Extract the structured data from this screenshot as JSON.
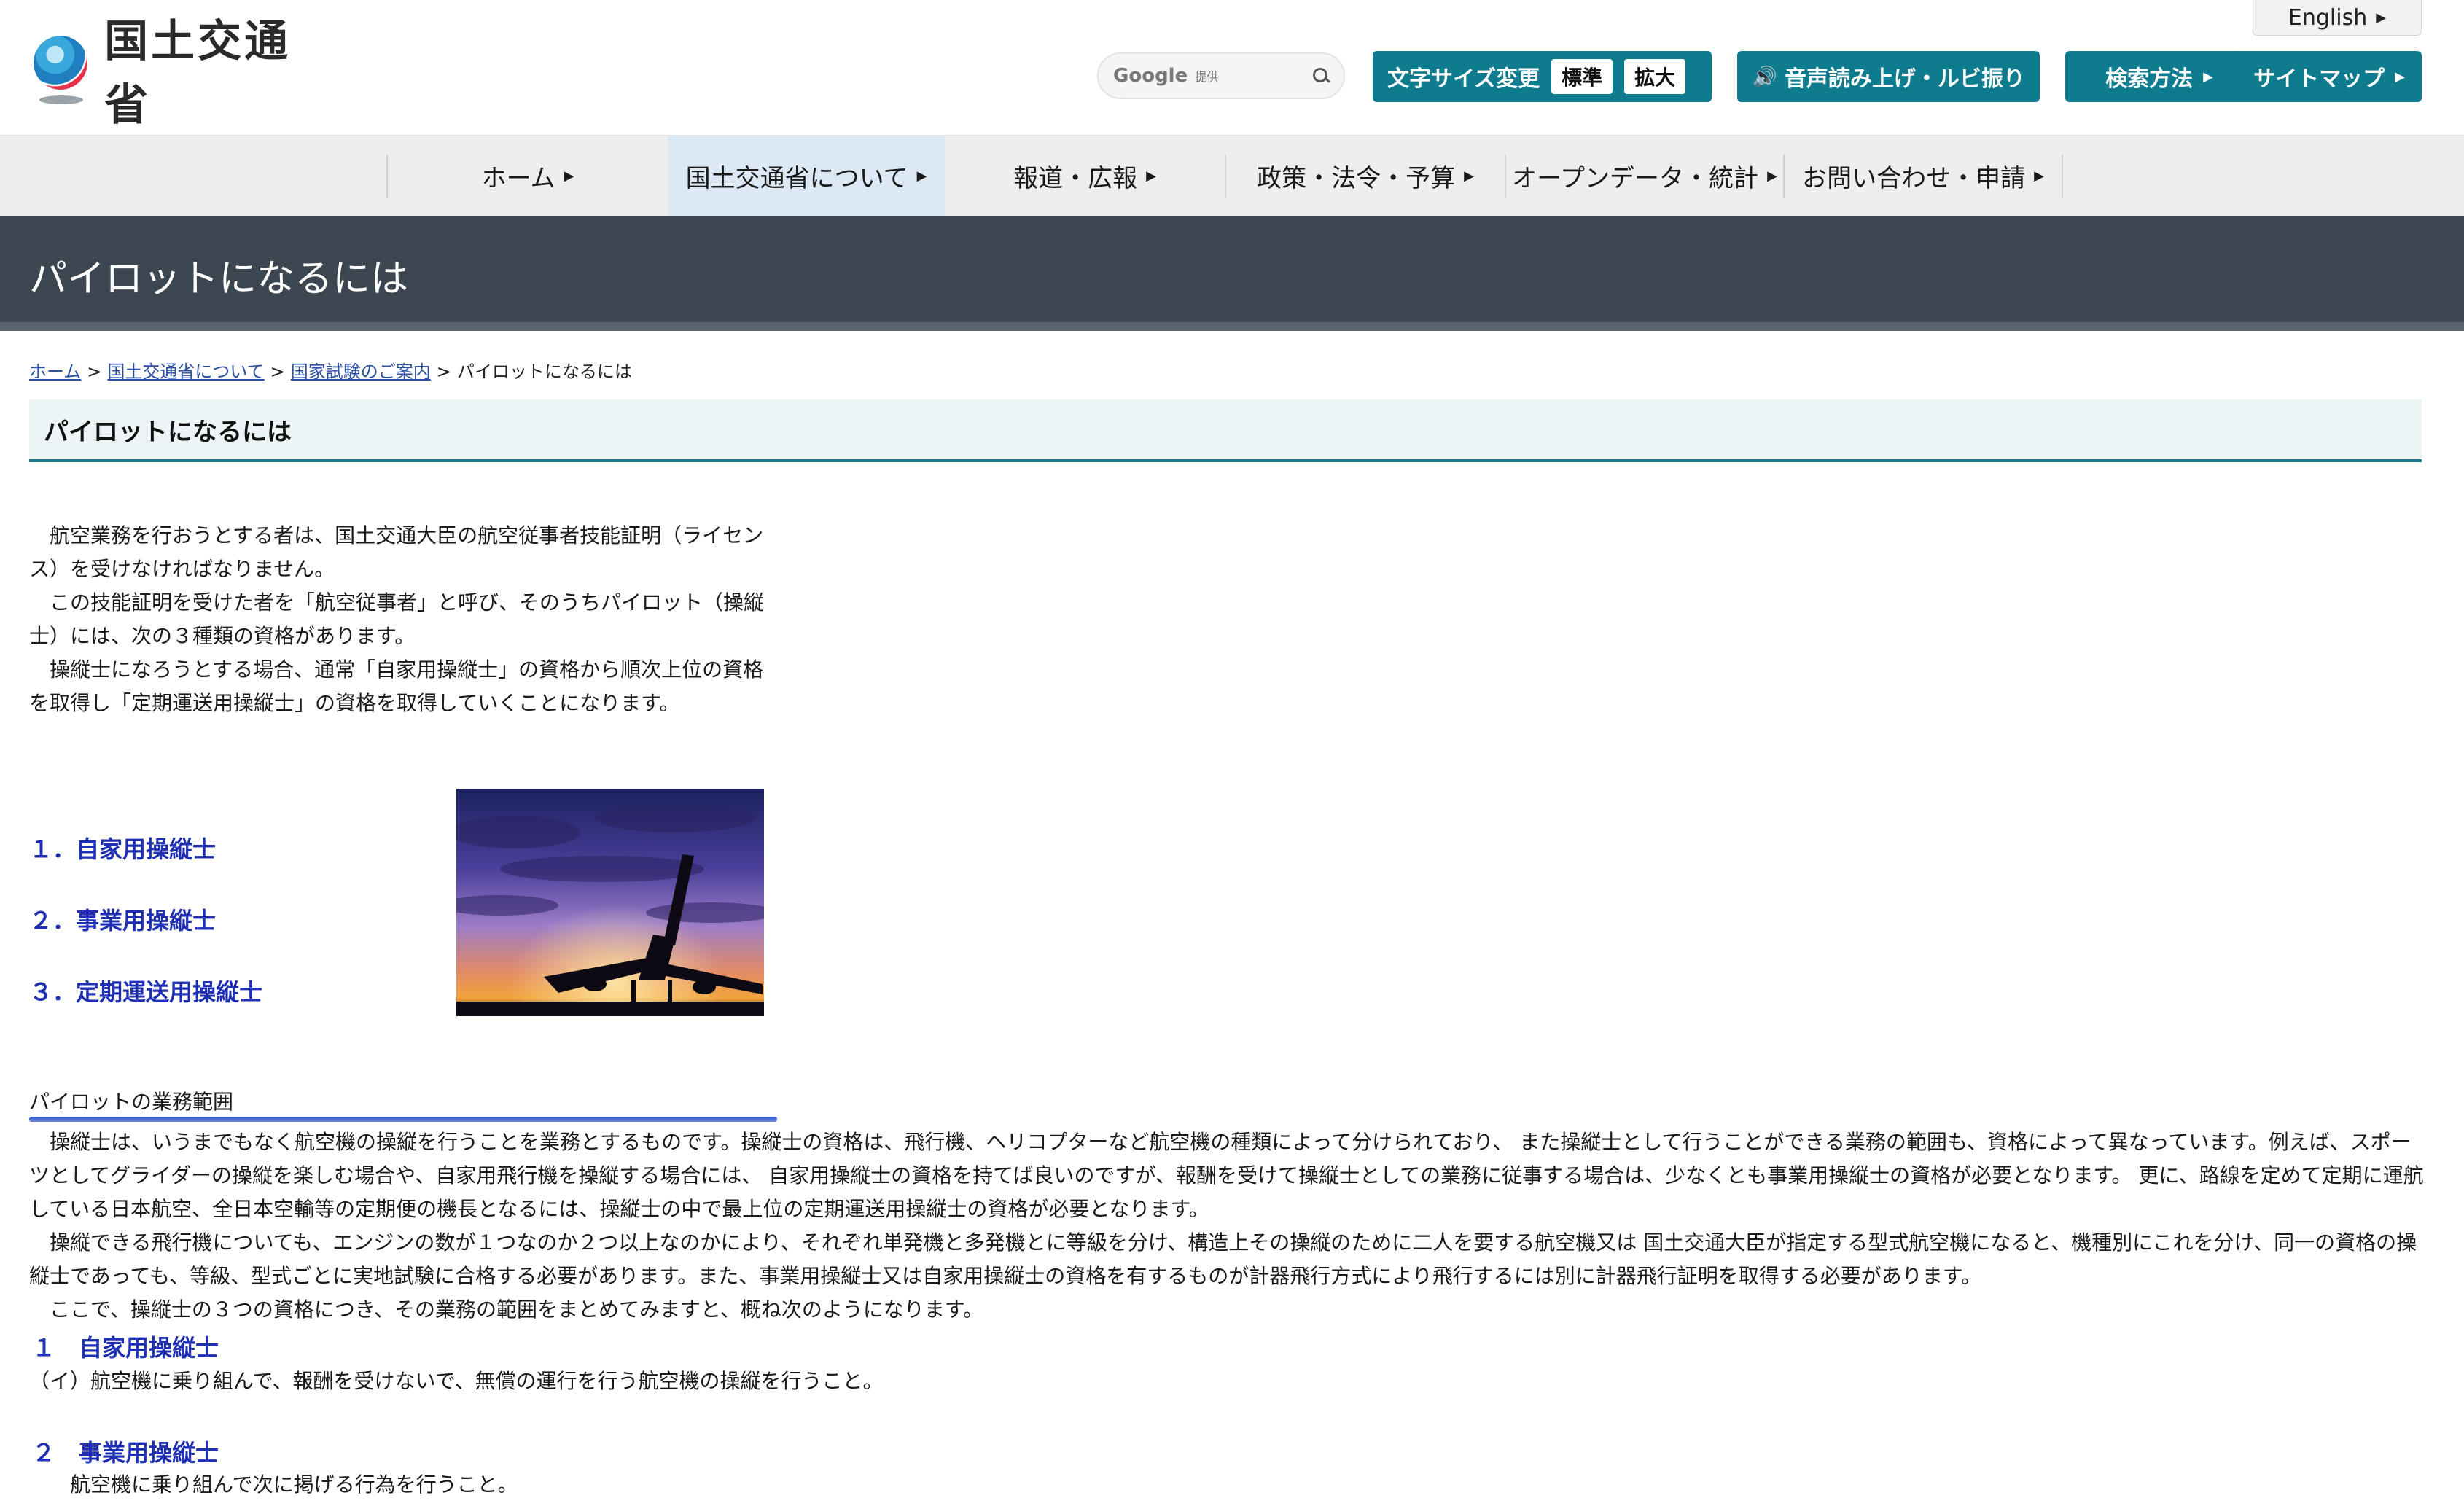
{
  "header": {
    "logo_text": "国土交通省",
    "english_label": "English",
    "search": {
      "brand": "Google",
      "provided": "提供"
    },
    "font_size": {
      "label": "文字サイズ変更",
      "standard": "標準",
      "large": "拡大"
    },
    "read_aloud_label": "音声読み上げ・ルビ振り",
    "search_help_label": "検索方法",
    "sitemap_label": "サイトマップ"
  },
  "nav": {
    "items": [
      {
        "label": "ホーム"
      },
      {
        "label": "国土交通省について"
      },
      {
        "label": "報道・広報"
      },
      {
        "label": "政策・法令・予算"
      },
      {
        "label": "オープンデータ・統計"
      },
      {
        "label": "お問い合わせ・申請"
      }
    ]
  },
  "page": {
    "title": "パイロットになるには",
    "breadcrumb": [
      "ホーム",
      "国土交通省について",
      "国家試験のご案内",
      "パイロットになるには"
    ],
    "heading": "パイロットになるには",
    "intro": [
      "航空業務を行おうとする者は、国土交通大臣の航空従事者技能証明（ライセンス）を受けなければなりません。",
      "この技能証明を受けた者を「航空従事者」と呼び、そのうちパイロット（操縦士）には、次の３種類の資格があります。",
      "操縦士になろうとする場合、通常「自家用操縦士」の資格から順次上位の資格を取得し「定期運送用操縦士」の資格を取得していくことになります。"
    ],
    "links": [
      "１．自家用操縦士",
      "２．事業用操縦士",
      "３．定期運送用操縦士"
    ],
    "scope_title": "パイロットの業務範囲",
    "scope_paragraphs": [
      "操縦士は、いうまでもなく航空機の操縦を行うことを業務とするものです。操縦士の資格は、飛行機、ヘリコプターなど航空機の種類によって分けられており、 また操縦士として行うことができる業務の範囲も、資格によって異なっています。例えば、スポーツとしてグライダーの操縦を楽しむ場合や、自家用飛行機を操縦する場合には、 自家用操縦士の資格を持てば良いのですが、報酬を受けて操縦士としての業務に従事する場合は、少なくとも事業用操縦士の資格が必要となります。 更に、路線を定めて定期に運航している日本航空、全日本空輸等の定期便の機長となるには、操縦士の中で最上位の定期運送用操縦士の資格が必要となります。",
      "操縦できる飛行機についても、エンジンの数が１つなのか２つ以上なのかにより、それぞれ単発機と多発機とに等級を分け、構造上その操縦のために二人を要する航空機又は 国土交通大臣が指定する型式航空機になると、機種別にこれを分け、同一の資格の操縦士であっても、等級、型式ごとに実地試験に合格する必要があります。また、事業用操縦士又は自家用操縦士の資格を有するものが計器飛行方式により飛行するには別に計器飛行証明を取得する必要があります。",
      "ここで、操縦士の３つの資格につき、その業務の範囲をまとめてみますと、概ね次のようになります。"
    ],
    "sub1_title": "１　自家用操縦士",
    "sub1_text": "（イ）航空機に乗り組んで、報酬を受けないで、無償の運行を行う航空機の操縦を行うこと。",
    "sub2_title": "２　事業用操縦士",
    "sub2_text": "航空機に乗り組んで次に掲げる行為を行うこと。"
  },
  "colors": {
    "accent": "#0e7b8e",
    "title_band": "#3c4650",
    "link": "#1f2fb3"
  }
}
